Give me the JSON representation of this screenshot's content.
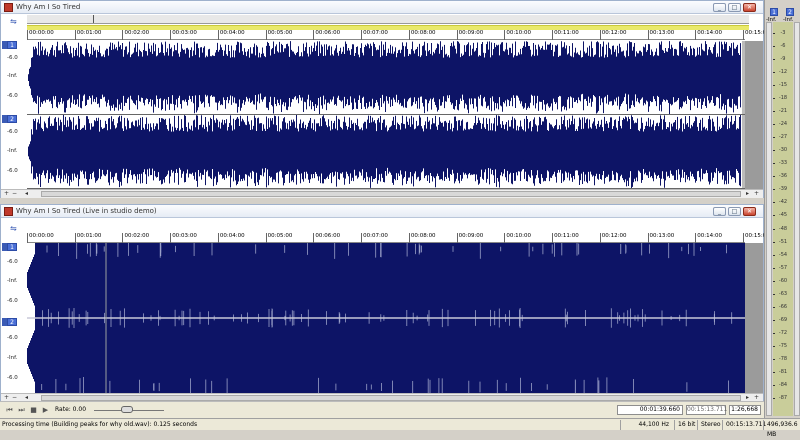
{
  "windows": [
    {
      "title": "Why Am I So Tired",
      "time_ticks": [
        "00:00:00",
        "00:01:00",
        "00:02:00",
        "00:03:00",
        "00:04:00",
        "00:05:00",
        "00:06:00",
        "00:07:00",
        "00:08:00",
        "00:09:00",
        "00:10:00",
        "00:11:00",
        "00:12:00",
        "00:13:00",
        "00:14:00",
        "00:15:00"
      ],
      "channels": [
        {
          "chip": "1",
          "db_labels": [
            "-6.0",
            "-Inf.",
            "-6.0"
          ]
        },
        {
          "chip": "2",
          "db_labels": [
            "-6.0",
            "-Inf.",
            "-6.0"
          ]
        }
      ]
    },
    {
      "title": "Why Am I So Tired (Live in studio demo)",
      "time_ticks": [
        "00:00:00",
        "00:01:00",
        "00:02:00",
        "00:03:00",
        "00:04:00",
        "00:05:00",
        "00:06:00",
        "00:07:00",
        "00:08:00",
        "00:09:00",
        "00:10:00",
        "00:11:00",
        "00:12:00",
        "00:13:00",
        "00:14:00",
        "00:15:00"
      ],
      "channels": [
        {
          "chip": "1",
          "db_labels": [
            "-6.0",
            "-Inf.",
            "-6.0"
          ]
        },
        {
          "chip": "2",
          "db_labels": [
            "-6.0",
            "-Inf.",
            "-6.0"
          ]
        }
      ]
    }
  ],
  "transport": {
    "rate_label": "Rate: 0.00",
    "cursor_time": "00:01:39.660",
    "length_time": "00:15:13.711",
    "zoom": "1:26,668"
  },
  "status": {
    "message": "Processing time (Building peaks for why old.wav): 0.125 seconds",
    "sample_rate": "44,100 Hz",
    "bit_depth": "16 bit",
    "channels": "Stereo",
    "duration": "00:15:13.711",
    "free_space": "496,936.6 MB"
  },
  "meter": {
    "chips": [
      "1",
      "2"
    ],
    "headers": [
      "-Inf.",
      "-Inf."
    ],
    "scale": [
      "-3",
      "-6",
      "-9",
      "-12",
      "-15",
      "-18",
      "-21",
      "-24",
      "-27",
      "-30",
      "-33",
      "-36",
      "-39",
      "-42",
      "-45",
      "-48",
      "-51",
      "-54",
      "-57",
      "-60",
      "-63",
      "-66",
      "-69",
      "-72",
      "-75",
      "-78",
      "-81",
      "-84",
      "-87"
    ]
  },
  "colors": {
    "waveform": "#0d1466",
    "waveform_bg": "#ffffff",
    "selected_bg": "#0d1466",
    "accent": "#4a6fd6"
  }
}
